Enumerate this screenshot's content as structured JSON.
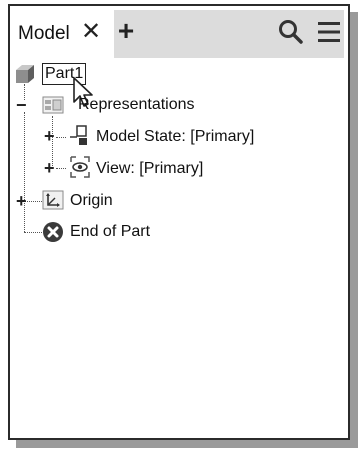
{
  "panel": {
    "tab_label": "Model",
    "close_glyph": "✕",
    "add_glyph": "+",
    "search_icon": "search-icon",
    "menu_icon": "menu-icon"
  },
  "tree": {
    "root": {
      "label": "Part1",
      "icon": "part-cube-icon"
    },
    "representations": {
      "label": "Representations",
      "icon": "representations-icon",
      "expander": "−"
    },
    "model_state": {
      "label": "Model State: [Primary]",
      "icon": "model-state-icon",
      "expander": "+"
    },
    "view": {
      "label": "View: [Primary]",
      "icon": "view-eye-icon",
      "expander": "+"
    },
    "origin": {
      "label": "Origin",
      "icon": "origin-icon",
      "expander": "+"
    },
    "end_of_part": {
      "label": "End of Part",
      "icon": "end-of-part-icon"
    }
  }
}
